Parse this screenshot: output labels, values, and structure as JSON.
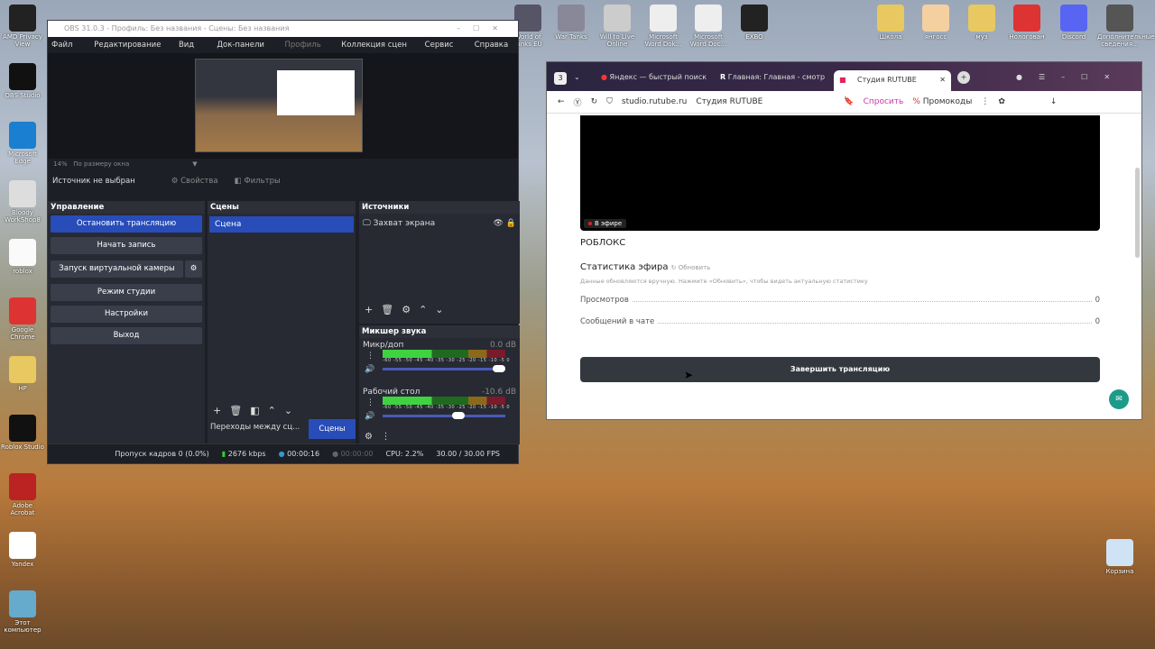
{
  "desktop": {
    "left_icons": [
      "AMD Privacy View",
      "OBS Studio",
      "Microsoft Edge",
      "Bloody WorkShop8",
      "roblox",
      "Google Chrome",
      "HP",
      "Roblox Studio",
      "Adobe Acrobat",
      "Yandex",
      "Этот компьютер"
    ],
    "top_icons": [
      "World of Tanks EU",
      "War Tanks",
      "Will to Live Online",
      "Microsoft Word Dok...",
      "Microsoft Word Doc...",
      "EXBO",
      "Школа",
      "янгосс",
      "муз",
      "Нологован",
      "Discord",
      "Дополнительные сведения..."
    ],
    "trash": "Корзина"
  },
  "obs": {
    "title": "OBS 31.0.3 - Профиль: Без названия - Сцены: Без названия",
    "menu": [
      "Файл (F)",
      "Редактирование (E)",
      "Вид (V)",
      "Док-панели (D)",
      "Профиль (P)",
      "Коллекция сцен (S)",
      "Сервис (T)",
      "Справка (H)"
    ],
    "zoom": "14%",
    "zoom_mode": "По размеру окна",
    "no_source": "Источник не выбран",
    "properties": "Свойства",
    "filters": "Фильтры",
    "controls": {
      "title": "Управление",
      "buttons": [
        "Остановить трансляцию",
        "Начать запись",
        "Запуск виртуальной камеры",
        "Режим студии",
        "Настройки",
        "Выход"
      ]
    },
    "scenes": {
      "title": "Сцены",
      "items": [
        "Сцена"
      ]
    },
    "sources": {
      "title": "Источники",
      "items": [
        "Захват экрана"
      ]
    },
    "mixer": {
      "title": "Микшер звука",
      "channels": [
        {
          "name": "Микр/доп",
          "db": "0.0 dB",
          "volume": 1.0
        },
        {
          "name": "Рабочий стол",
          "db": "-10.6 dB",
          "volume": 0.67
        }
      ],
      "scale": "-60 -55 -50 -45 -40 -35 -30 -25 -20 -15 -10 -5 0"
    },
    "tabs": {
      "transitions": "Переходы между сц...",
      "scenes": "Сцены"
    },
    "status": {
      "dropped": "Пропуск кадров 0 (0.0%)",
      "bitrate": "2676 kbps",
      "stream_time": "00:00:16",
      "rec_time": "00:00:00",
      "cpu": "CPU: 2.2%",
      "fps": "30.00 / 30.00 FPS"
    }
  },
  "browser": {
    "tab_count": "3",
    "tabs": [
      "Яндекс — быстрый поиск",
      "Главная: Главная - смотр",
      "Студия RUTUBE"
    ],
    "url": "studio.rutube.ru",
    "page_title": "Студия RUTUBE",
    "ask": "Спросить",
    "promo": "Промокоды",
    "live_badge": "В эфире",
    "stream_title": "РОБЛОКС",
    "stats_title": "Статистика эфира",
    "refresh": "Обновить",
    "stats_note": "Данные обновляются вручную. Нажмите «Обновить», чтобы видеть актуальную статистику",
    "stats": [
      {
        "label": "Просмотров",
        "value": "0"
      },
      {
        "label": "Сообщений в чате",
        "value": "0"
      }
    ],
    "end_button": "Завершить трансляцию"
  }
}
